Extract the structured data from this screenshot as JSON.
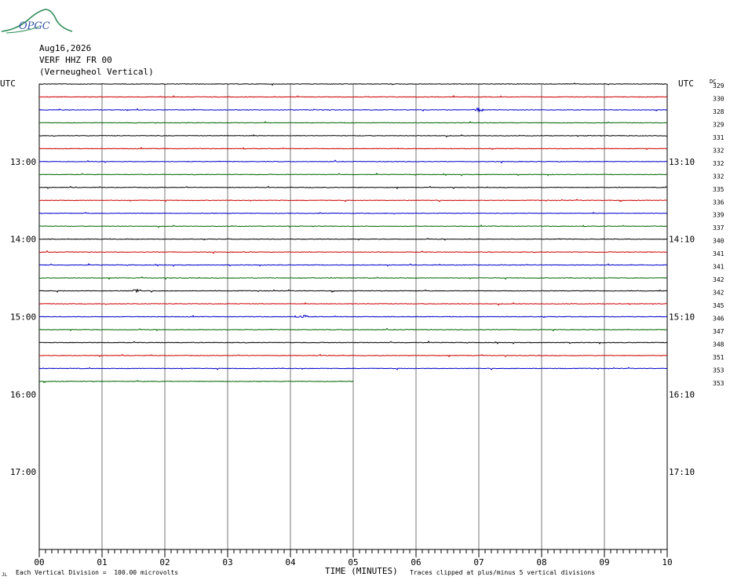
{
  "logo": {
    "text": "OPGC",
    "icon": "volcano-logo-icon"
  },
  "header": {
    "date": "Aug16,2026",
    "station": "VERF HHZ FR 00",
    "location": "(Verneugheol Vertical)"
  },
  "footer": {
    "scale_note": "Each Vertical Division =  100.00 microvolts",
    "xlabel": "TIME (MINUTES)",
    "clip_note": "Traces clipped at plus/minus 5 vertical divisions",
    "corner_mark": "JL"
  },
  "chart_data": {
    "type": "line",
    "title": "",
    "xlabel": "TIME (MINUTES)",
    "ylabel": "",
    "xlim": [
      0,
      10
    ],
    "x_ticks": [
      "00",
      "01",
      "02",
      "03",
      "04",
      "05",
      "06",
      "07",
      "08",
      "09",
      "10"
    ],
    "left_axis_title": "UTC",
    "right_axis_title": "UTC",
    "dc_title": "DC",
    "left_hour_labels": [
      "13:00",
      "14:00",
      "15:00",
      "16:00",
      "17:00"
    ],
    "right_hour_labels": [
      "13:10",
      "14:10",
      "15:10",
      "16:10",
      "17:10"
    ],
    "hour_label_rows": [
      6,
      12,
      18,
      24,
      30
    ],
    "total_rows": 36,
    "grid": true,
    "series_colors": [
      "#000000",
      "#cc0000",
      "#0000cc",
      "#006600"
    ],
    "traces": [
      {
        "row": 0,
        "color": "#000000",
        "end_minute": 10,
        "dc": "329"
      },
      {
        "row": 1,
        "color": "#cc0000",
        "end_minute": 10,
        "dc": "330"
      },
      {
        "row": 2,
        "color": "#0000cc",
        "end_minute": 10,
        "dc": "328",
        "event_minute": 7.0
      },
      {
        "row": 3,
        "color": "#006600",
        "end_minute": 10,
        "dc": "329"
      },
      {
        "row": 4,
        "color": "#000000",
        "end_minute": 10,
        "dc": "331"
      },
      {
        "row": 5,
        "color": "#cc0000",
        "end_minute": 10,
        "dc": "332"
      },
      {
        "row": 6,
        "color": "#0000cc",
        "end_minute": 10,
        "dc": "332"
      },
      {
        "row": 7,
        "color": "#006600",
        "end_minute": 10,
        "dc": "332"
      },
      {
        "row": 8,
        "color": "#000000",
        "end_minute": 10,
        "dc": "335"
      },
      {
        "row": 9,
        "color": "#cc0000",
        "end_minute": 10,
        "dc": "336"
      },
      {
        "row": 10,
        "color": "#0000cc",
        "end_minute": 10,
        "dc": "339"
      },
      {
        "row": 11,
        "color": "#006600",
        "end_minute": 10,
        "dc": "337"
      },
      {
        "row": 12,
        "color": "#000000",
        "end_minute": 10,
        "dc": "340"
      },
      {
        "row": 13,
        "color": "#cc0000",
        "end_minute": 10,
        "dc": "341"
      },
      {
        "row": 14,
        "color": "#0000cc",
        "end_minute": 10,
        "dc": "341"
      },
      {
        "row": 15,
        "color": "#006600",
        "end_minute": 10,
        "dc": "342"
      },
      {
        "row": 16,
        "color": "#000000",
        "end_minute": 10,
        "dc": "342",
        "event_minute": 1.55
      },
      {
        "row": 17,
        "color": "#cc0000",
        "end_minute": 10,
        "dc": "345"
      },
      {
        "row": 18,
        "color": "#0000cc",
        "end_minute": 10,
        "dc": "346",
        "event_minute": 4.2
      },
      {
        "row": 19,
        "color": "#006600",
        "end_minute": 10,
        "dc": "347"
      },
      {
        "row": 20,
        "color": "#000000",
        "end_minute": 10,
        "dc": "348"
      },
      {
        "row": 21,
        "color": "#cc0000",
        "end_minute": 10,
        "dc": "351"
      },
      {
        "row": 22,
        "color": "#0000cc",
        "end_minute": 10,
        "dc": "353"
      },
      {
        "row": 23,
        "color": "#006600",
        "end_minute": 5,
        "dc": "353"
      }
    ]
  }
}
